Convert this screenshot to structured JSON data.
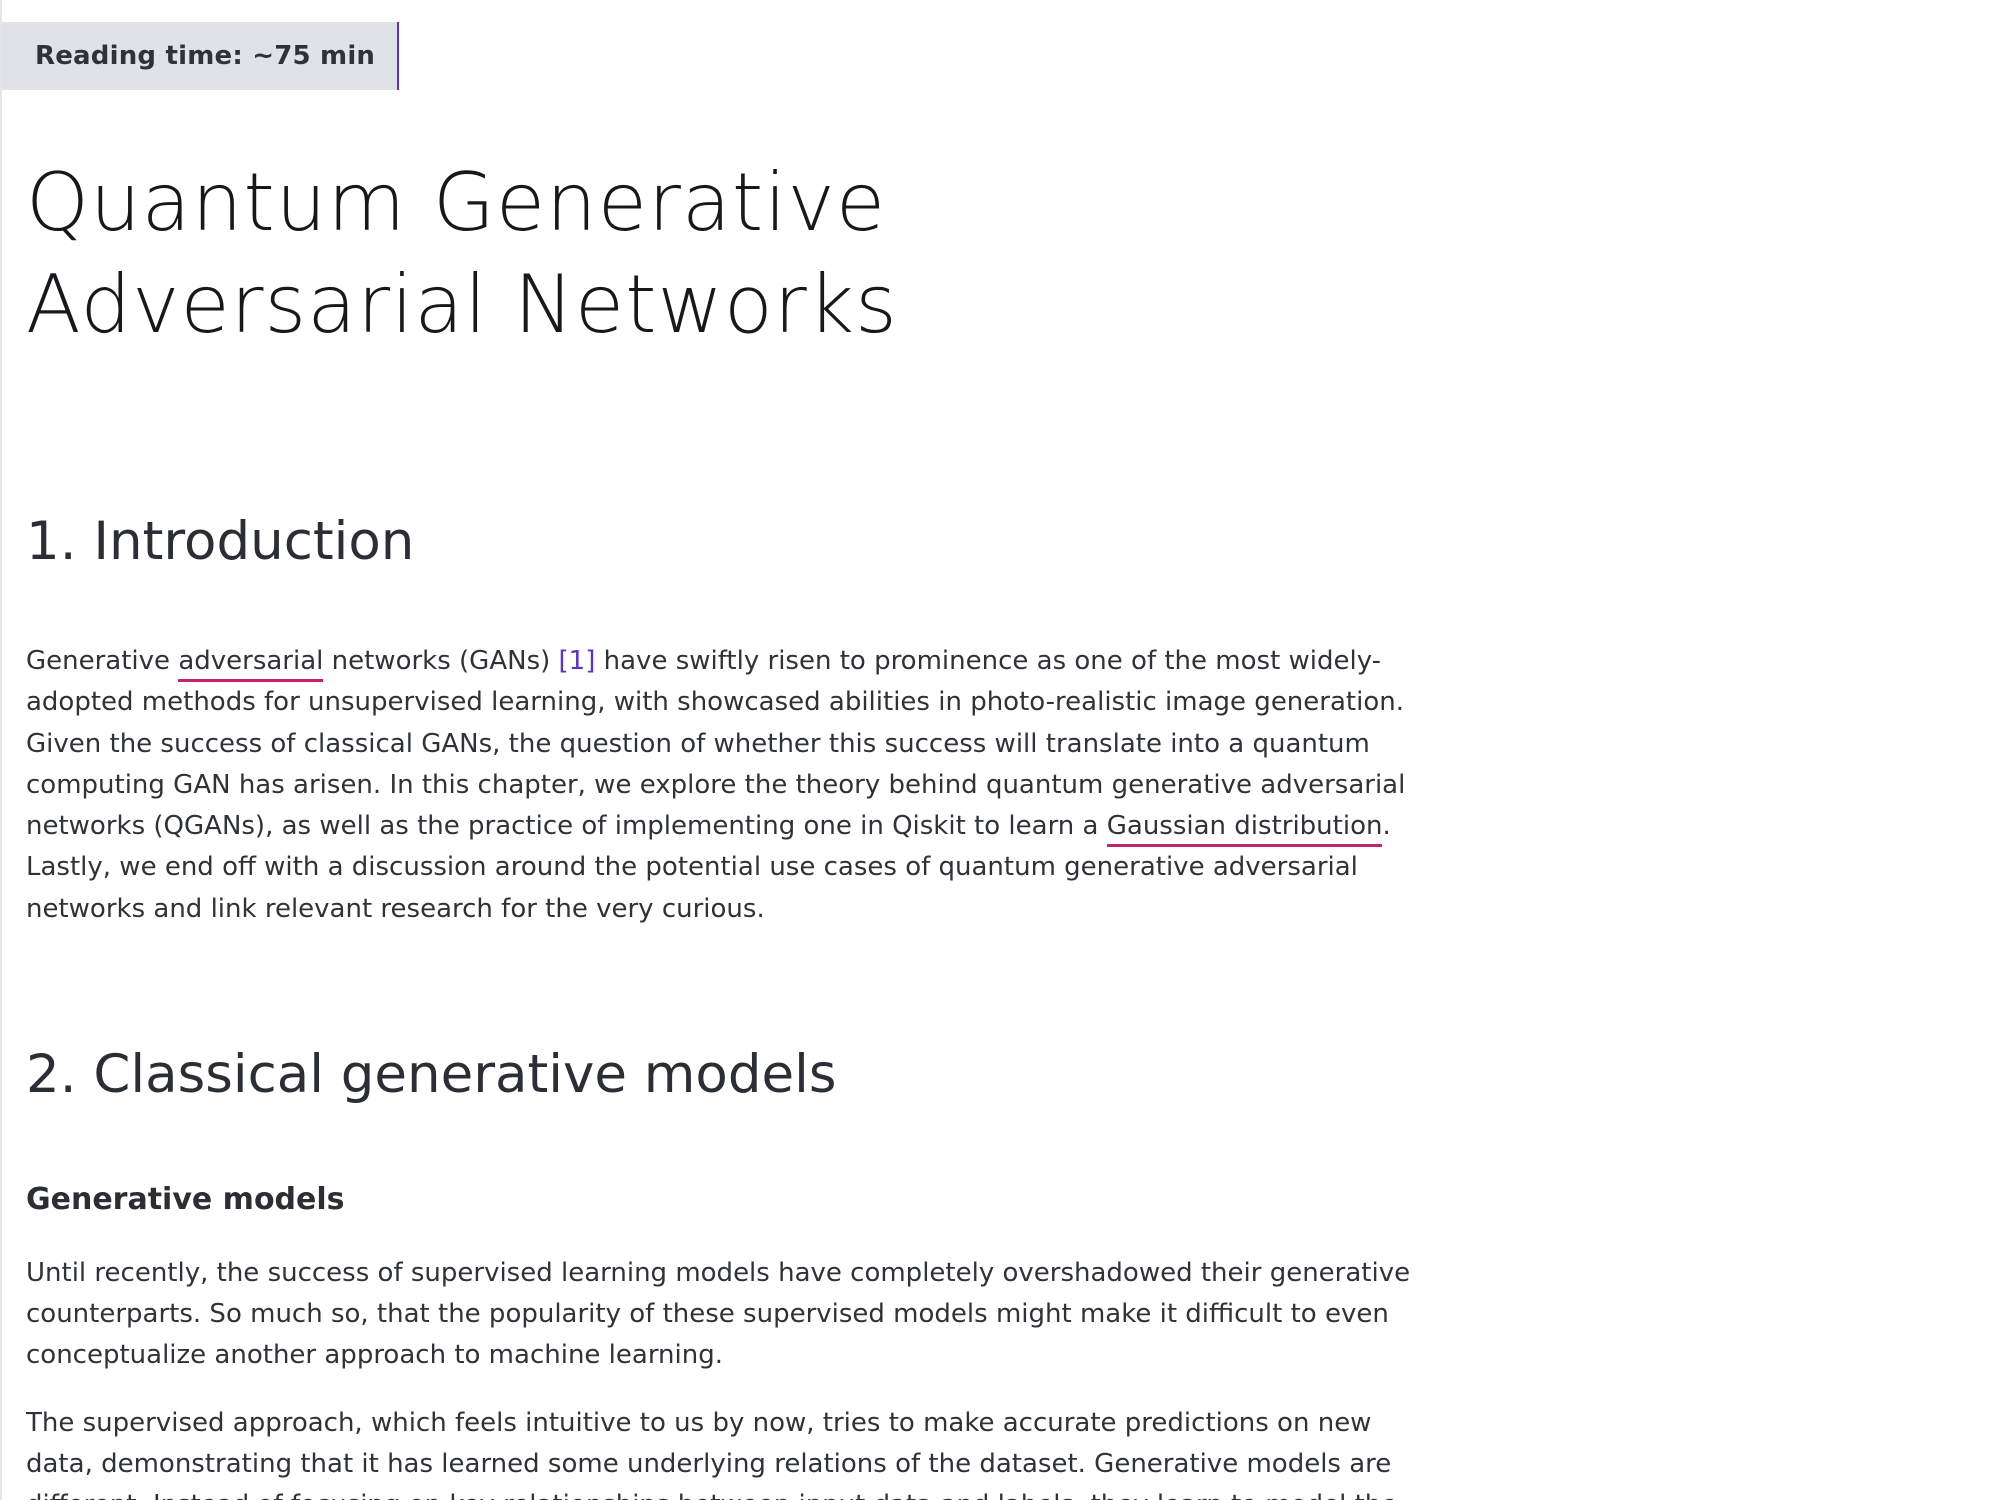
{
  "reading_time": "Reading time: ~75 min",
  "title": {
    "line1": "Quantum Generative",
    "line2": "Adversarial Networks"
  },
  "sections": {
    "intro": {
      "heading": "1. Introduction",
      "paragraph": {
        "l1_a": "Generative ",
        "term_adversarial": "adversarial",
        "l1_b": " networks (GANs) ",
        "citation": "[1]",
        "l1_c": " have swiftly risen to prominence as one of the most widely-",
        "l2": "adopted methods for unsupervised learning, with showcased abilities in photo-realistic image generation.",
        "l3": "Given the success of classical GANs, the question of whether this success will translate into a quantum",
        "l4": "computing GAN has arisen. In this chapter, we explore the theory behind quantum generative adversarial",
        "l5_a": "networks (QGANs), as well as the practice of implementing one in Qiskit to learn a ",
        "term_gaussian": "Gaussian distribution",
        "l5_b": ".",
        "l6": "Lastly, we end off with a discussion around the potential use cases of quantum generative adversarial",
        "l7": "networks and link relevant research for the very curious."
      }
    },
    "classical": {
      "heading": "2. Classical generative models",
      "subheading": "Generative models",
      "paragraph1": {
        "l1": "Until recently, the success of supervised learning models have completely overshadowed their generative",
        "l2": "counterparts. So much so, that the popularity of these supervised models might make it difficult to even",
        "l3": "conceptualize another approach to machine learning."
      },
      "paragraph2": {
        "l1": "The supervised approach, which feels intuitive to us by now, tries to make accurate predictions on new",
        "l2": "data, demonstrating that it has learned some underlying relations of the dataset. Generative models are",
        "l3": "different. Instead of focusing on key relationships between input data and labels, they learn to model the"
      }
    }
  },
  "colors": {
    "accent": "#5b33c7",
    "term_underline": "#c0266d",
    "badge_bg": "#dfe2e7"
  }
}
